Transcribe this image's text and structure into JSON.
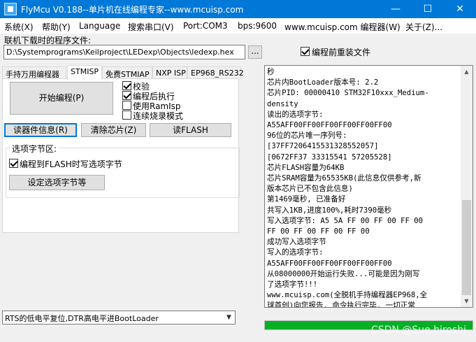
{
  "window": {
    "title": "FlyMcu V0.188--单片机在线编程专家--www.mcuisp.com",
    "minimize": "—",
    "maximize": "☐",
    "close": "✕"
  },
  "menu": [
    "系统(X)",
    "帮助(Y)",
    "Language",
    "搜索串口(V)",
    "Port:COM3",
    "bps:9600",
    "www.mcuisp.com 编程器(W)",
    "关于(Z)..."
  ],
  "file": {
    "label": "联机下载时的程序文件:",
    "path": "D:\\Systemprograms\\Keilproject\\LEDexp\\Objects\\ledexp.hex",
    "browse_label": "...",
    "reload_label": "编程前重装文件",
    "reload_checked": true
  },
  "tabs": [
    "手持万用编程器",
    "STMISP",
    "免费STMIAP",
    "NXP ISP",
    "EP968_RS232"
  ],
  "active_tab": "STMISP",
  "program": {
    "start_label": "开始编程(P)",
    "options": [
      {
        "label": "校验",
        "checked": true
      },
      {
        "label": "编程后执行",
        "checked": true
      },
      {
        "label": "使用RamIsp",
        "checked": false
      },
      {
        "label": "连续烧录模式",
        "checked": false
      }
    ],
    "read_info_label": "读器件信息(R)",
    "erase_label": "清除芯片(Z)",
    "read_flash_label": "读FLASH"
  },
  "option_bytes": {
    "group_label": "选项字节区:",
    "write_label": "编程到FLASH时写选项字节",
    "write_checked": true,
    "set_label": "设定选项字节等"
  },
  "log_lines": [
    "秒",
    "芯片内BootLoader版本号: 2.2",
    "芯片PID: 00000410  STM32F10xxx_Medium-",
    "density",
    "读出的选项字节:",
    "A55AFF00FF00FF00FF00FF00FF00",
    "96位的芯片唯一序列号:",
    "[37FF7206415531328552057]",
    "[0672FF37 33315541 57205528]",
    "芯片FLASH容量为64KB",
    "芯片SRAM容量为65535KB(此信息仅供参考,新",
    "版本芯片已不包含此信息)",
    "第1469毫秒, 已准备好",
    "共写入1KB,进度100%,耗时7390毫秒",
    "写入选项字节:  A5 5A FF 00 FF 00 FF 00",
    "FF 00 FF 00 FF 00 FF 00",
    "成功写入选项字节",
    "写入的选项字节:",
    "A55AFF00FF00FF00FF00FF00FF00",
    "从08000000开始运行失败...可能是因为刚写",
    "了选项字节!!!",
    "www.mcuisp.com(全脱机手持编程器EP968,全",
    "球首创)向您报告, 命令执行完毕, 一切正常"
  ],
  "progress": {
    "fraction": 1.0,
    "color": "#06b025"
  },
  "reset_mode": {
    "selected": "RTS的低电平复位,DTR高电平进BootLoader"
  },
  "watermark": "CSDN @Sue hiroshi",
  "colors": {
    "titlebar": "#0078d7",
    "accent": "#0078d7"
  }
}
